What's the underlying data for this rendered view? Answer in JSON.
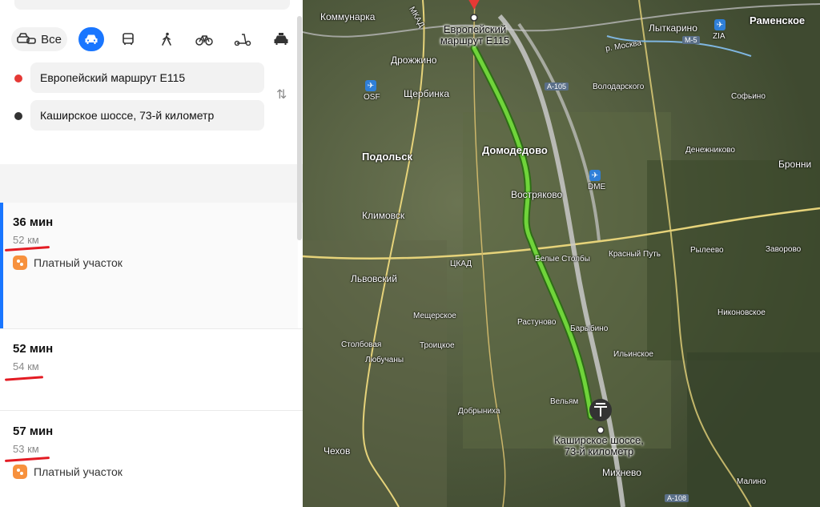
{
  "modes": [
    {
      "name": "all",
      "label": "Все"
    },
    {
      "name": "car"
    },
    {
      "name": "bus"
    },
    {
      "name": "walk"
    },
    {
      "name": "bike"
    },
    {
      "name": "scooter"
    },
    {
      "name": "taxi"
    }
  ],
  "from": {
    "value": "Европейский маршрут E115",
    "color": "#e53935"
  },
  "to": {
    "value": "Каширское шоссе, 73-й километр",
    "color": "#333333"
  },
  "swap_icon": "swap-icon",
  "routes": [
    {
      "time": "36 мин",
      "distance": "52 км",
      "toll": "Платный участок",
      "selected": true
    },
    {
      "time": "52 мин",
      "distance": "54 км"
    },
    {
      "time": "57 мин",
      "distance": "53 км",
      "toll": "Платный участок"
    }
  ],
  "map": {
    "start_label": "Европейский\nмаршрут E115",
    "end_label": "Каширское шоссе,\n73-й километр",
    "route_color": "#6fd43a",
    "places": [
      "Коммунарка",
      "Лыткарино",
      "Раменское",
      "Дрожжино",
      "Щербинка",
      "Володарского",
      "Софьино",
      "Подольск",
      "Домодедово",
      "Денежниково",
      "Бронни",
      "Востряково",
      "Климовск",
      "Красный Путь",
      "Рылеево",
      "Заворово",
      "Белые Столбы",
      "Львовский",
      "Мещерское",
      "Растуново",
      "Барыбино",
      "Никоновское",
      "Ильинское",
      "Столбовая",
      "Троицкое",
      "Любучаны",
      "Вельям",
      "Добрыниха",
      "Чехов",
      "Михнево",
      "Малино"
    ],
    "roads": [
      "МКАД",
      "ЦКАД",
      "А-105",
      "М-5",
      "А-108",
      "р. Москва"
    ],
    "airports": [
      {
        "icon": "airport-icon",
        "label": "OSF"
      },
      {
        "icon": "airport-icon",
        "label": "DME"
      },
      {
        "icon": "airport-icon",
        "label": "ZIA"
      }
    ]
  }
}
